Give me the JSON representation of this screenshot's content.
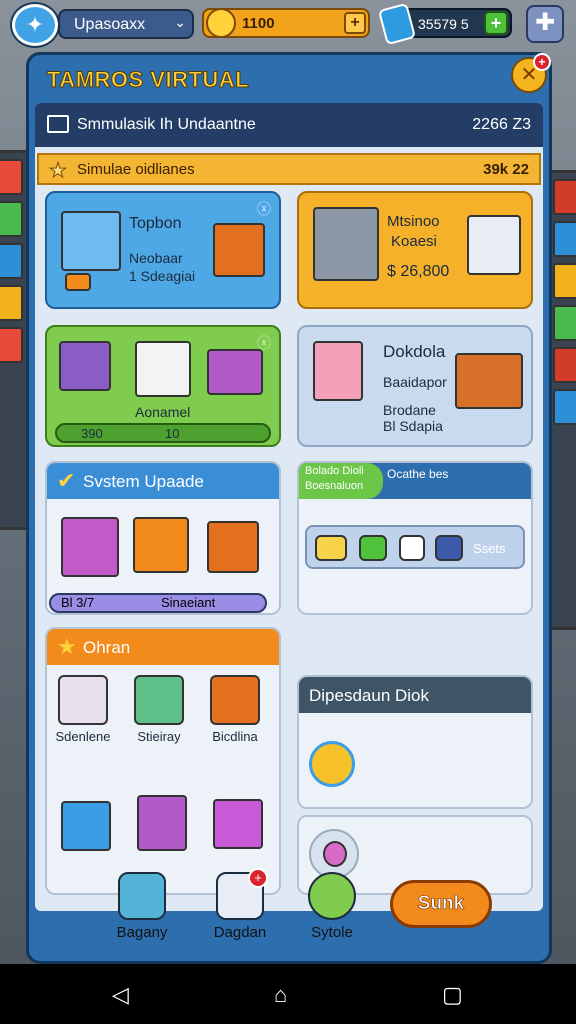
{
  "header": {
    "profile_name": "Upasoaxx",
    "coins": "1100",
    "gems": "35579 5"
  },
  "window": {
    "title": "TAMROS VIRTUAL",
    "info_text": "Smmulasik Ih Undaantne",
    "info_num": "2266 Z3",
    "sub_text": "Simulae oidlianes",
    "sub_num": "39k 22"
  },
  "cards": {
    "topbon": {
      "title": "Topbon",
      "line1": "Neobaar",
      "line2": "1 Sdeagiai"
    },
    "mixed": {
      "title": "Mtsinoo",
      "line2": "Koaesi",
      "price": "$ 26,800"
    },
    "green": {
      "label": "Aonamel",
      "bar_value": "390",
      "bar_right": "10"
    },
    "dokdola": {
      "title": "Dokdola",
      "line1": "Baaidapor",
      "line2": "Brodane",
      "line3": "Bl Sdapia"
    }
  },
  "system": {
    "heading": "Svstem Upaade",
    "pill_left": "Bl 3/7",
    "pill_right": "Sinaeiant"
  },
  "right_mid": {
    "green_badge_1": "Bolado Dioli",
    "green_badge_2": "Boesnaluon",
    "right_text": "Ocathe bes",
    "toggle_label": "Ssets"
  },
  "ohran": {
    "heading": "Ohran",
    "items": [
      {
        "label": "Sdenlene"
      },
      {
        "label": "Stieiray"
      },
      {
        "label": "Bicdlina"
      }
    ]
  },
  "dipesdaun": {
    "heading": "Dipesdaun Diok"
  },
  "bottom_nav": {
    "items": [
      {
        "label": "Bagany"
      },
      {
        "label": "Dagdan"
      },
      {
        "label": "Sytole"
      }
    ],
    "badge": "+",
    "action_label": "Sunk"
  },
  "colors": {
    "window_blue": "#2d6fae",
    "accent_orange": "#f28a1c",
    "accent_green": "#7fcc4e",
    "title_yellow": "#ffd43b"
  }
}
